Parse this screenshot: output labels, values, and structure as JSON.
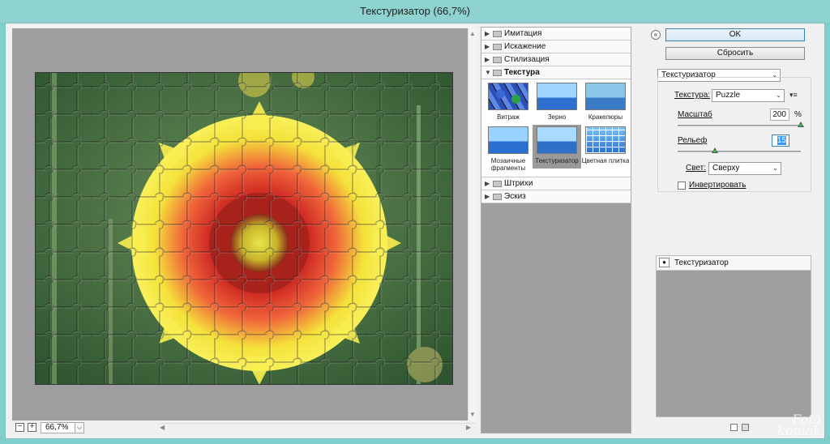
{
  "window": {
    "title": "Текстуризатор (66,7%)"
  },
  "preview": {
    "zoom": "66,7%",
    "zoom_out_symbol": "−",
    "zoom_in_symbol": "+",
    "dropdown_symbol": "⌵",
    "scroll_up_symbol": "▲",
    "scroll_down_symbol": "▼",
    "scroll_left_symbol": "◀",
    "scroll_right_symbol": "▶"
  },
  "gallery": {
    "collapsed_symbol": "▶",
    "expanded_symbol": "▼",
    "categories_top": [
      "Имитация",
      "Искажение",
      "Стилизация"
    ],
    "open_category": "Текстура",
    "thumbnails": [
      {
        "label": "Витраж"
      },
      {
        "label": "Зерно"
      },
      {
        "label": "Кракелюры"
      },
      {
        "label": "Мозаичные фрагменты"
      },
      {
        "label": "Текстуризатор",
        "selected": true
      },
      {
        "label": "Цветная плитка"
      }
    ],
    "categories_bottom": [
      "Штрихи",
      "Эскиз"
    ]
  },
  "panel": {
    "collapse_symbol": "«",
    "ok_label": "OK",
    "reset_label": "Сбросить",
    "filter_select": "Текстуризатор",
    "texture_label": "Текстура:",
    "texture_value": "Puzzle",
    "texture_menu_symbol": "▾≡",
    "scale_label": "Масштаб",
    "scale_value": "200",
    "scale_unit": "%",
    "relief_label": "Рельеф",
    "relief_value": "15",
    "light_label": "Свет:",
    "light_value": "Сверху",
    "invert_label": "Инвертировать",
    "select_chevron": "⌄",
    "scale_slider_fraction": 1.0,
    "relief_slider_fraction": 0.3
  },
  "layers": {
    "items": [
      {
        "label": "Текстуризатор",
        "visible": true
      }
    ],
    "eye_symbol": "●"
  },
  "watermark": "Foto\nkomok"
}
